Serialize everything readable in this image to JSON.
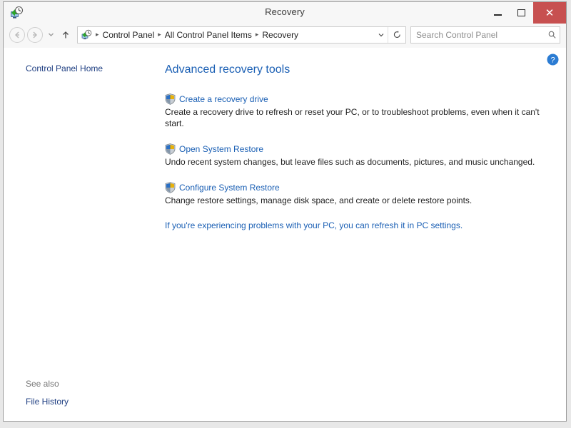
{
  "window": {
    "title": "Recovery",
    "icon": "recovery-monitor-clock-icon",
    "controls": {
      "minimize_label": "–",
      "maximize_label": "□",
      "close_label": "✕"
    }
  },
  "navbar": {
    "back_label": "Back",
    "forward_label": "Forward",
    "recent_label": "Recent locations",
    "up_label": "Up one level",
    "breadcrumbs": [
      {
        "label": "Control Panel"
      },
      {
        "label": "All Control Panel Items"
      },
      {
        "label": "Recovery"
      }
    ],
    "separator": "▸",
    "dropdown_label": "∨",
    "refresh_label": "Refresh",
    "search": {
      "placeholder": "Search Control Panel",
      "value": "",
      "icon": "search-icon"
    }
  },
  "sidebar": {
    "home_link": "Control Panel Home",
    "see_also_title": "See also",
    "see_also_links": [
      {
        "label": "File History"
      }
    ]
  },
  "content": {
    "heading": "Advanced recovery tools",
    "help_label": "?",
    "tools": [
      {
        "link": "Create a recovery drive",
        "description": "Create a recovery drive to refresh or reset your PC, or to troubleshoot problems, even when it can't start.",
        "icon": "uac-shield-icon"
      },
      {
        "link": "Open System Restore",
        "description": "Undo recent system changes, but leave files such as documents, pictures, and music unchanged.",
        "icon": "uac-shield-icon"
      },
      {
        "link": "Configure System Restore",
        "description": "Change restore settings, manage disk space, and create or delete restore points.",
        "icon": "uac-shield-icon"
      }
    ],
    "refresh_note": "If you're experiencing problems with your PC, you can refresh it in PC settings."
  },
  "colors": {
    "link_blue": "#1a5fb4",
    "sidebar_link": "#1f3f82",
    "close_red": "#c75050",
    "window_chrome": "#f7f7f7",
    "help_blue": "#2b7cd3"
  }
}
